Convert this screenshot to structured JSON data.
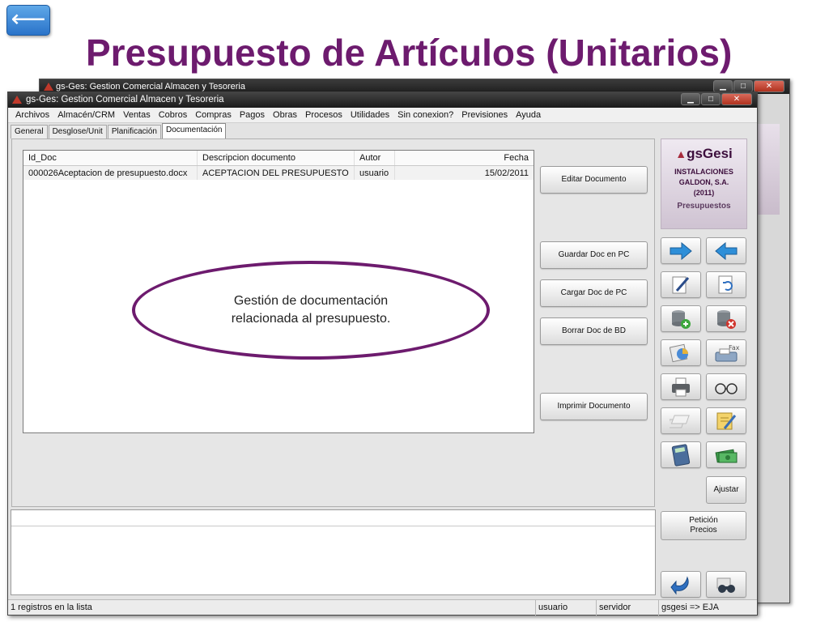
{
  "slide": {
    "back_glyph": "⟵",
    "title": "Presupuesto de Artículos (Unitarios)"
  },
  "back_window": {
    "title": "gs-Ges: Gestion Comercial Almacen y Tesoreria"
  },
  "window": {
    "title": "gs-Ges: Gestion Comercial Almacen y Tesoreria",
    "controls": {
      "minimize": "▁",
      "maximize": "□",
      "close": "✕"
    }
  },
  "menu": {
    "items": [
      "Archivos",
      "Almacén/CRM",
      "Ventas",
      "Cobros",
      "Compras",
      "Pagos",
      "Obras",
      "Procesos",
      "Utilidades",
      "Sin conexion?",
      "Previsiones",
      "Ayuda"
    ]
  },
  "tabs": [
    "General",
    "Desglose/Unit",
    "Planificación",
    "Documentación"
  ],
  "active_tab": "Documentación",
  "documents": {
    "columns": [
      "Id_Doc",
      "Descripcion documento",
      "Autor",
      "Fecha"
    ],
    "rows": [
      [
        "000026Aceptacion de presupuesto.docx",
        "ACEPTACION DEL PRESUPUESTO",
        "usuario",
        "15/02/2011"
      ]
    ]
  },
  "callout": "Gestión de documentación relacionada al presupuesto.",
  "actions": {
    "edit": "Editar Documento",
    "save_pc": "Guardar Doc en PC",
    "load_pc": "Cargar Doc de PC",
    "delete_db": "Borrar Doc de BD",
    "print": "Imprimir Documento"
  },
  "brand": {
    "logo": "gsGesi",
    "company_line1": "INSTALACIONES",
    "company_line2": "GALDON, S.A.",
    "year": "(2011)",
    "module": "Presupuestos"
  },
  "side_buttons": {
    "fax_label": "Fax",
    "adjust": "Ajustar",
    "price_request": "Petición Precios"
  },
  "status": {
    "records": "1 registros en la lista",
    "user": "usuario",
    "server": "servidor",
    "db": "gsgesi => EJA"
  },
  "colors": {
    "accent": "#6d1b6e",
    "titlebar": "#1b1b1b",
    "back_button": "#2a73c9"
  }
}
